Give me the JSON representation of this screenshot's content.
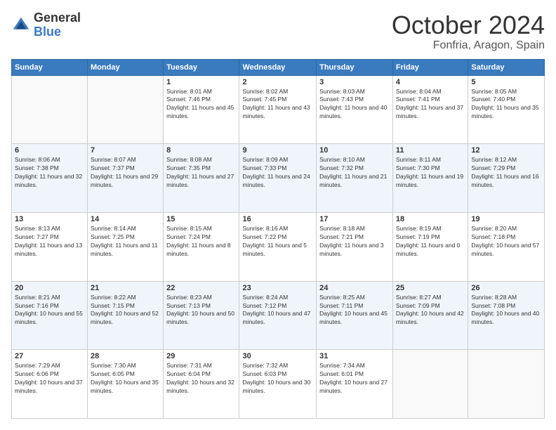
{
  "header": {
    "logo_general": "General",
    "logo_blue": "Blue",
    "month_title": "October 2024",
    "location": "Fonfria, Aragon, Spain"
  },
  "weekdays": [
    "Sunday",
    "Monday",
    "Tuesday",
    "Wednesday",
    "Thursday",
    "Friday",
    "Saturday"
  ],
  "weeks": [
    [
      {
        "day": "",
        "info": ""
      },
      {
        "day": "",
        "info": ""
      },
      {
        "day": "1",
        "info": "Sunrise: 8:01 AM\nSunset: 7:46 PM\nDaylight: 11 hours and 45 minutes."
      },
      {
        "day": "2",
        "info": "Sunrise: 8:02 AM\nSunset: 7:45 PM\nDaylight: 11 hours and 43 minutes."
      },
      {
        "day": "3",
        "info": "Sunrise: 8:03 AM\nSunset: 7:43 PM\nDaylight: 11 hours and 40 minutes."
      },
      {
        "day": "4",
        "info": "Sunrise: 8:04 AM\nSunset: 7:41 PM\nDaylight: 11 hours and 37 minutes."
      },
      {
        "day": "5",
        "info": "Sunrise: 8:05 AM\nSunset: 7:40 PM\nDaylight: 11 hours and 35 minutes."
      }
    ],
    [
      {
        "day": "6",
        "info": "Sunrise: 8:06 AM\nSunset: 7:38 PM\nDaylight: 11 hours and 32 minutes."
      },
      {
        "day": "7",
        "info": "Sunrise: 8:07 AM\nSunset: 7:37 PM\nDaylight: 11 hours and 29 minutes."
      },
      {
        "day": "8",
        "info": "Sunrise: 8:08 AM\nSunset: 7:35 PM\nDaylight: 11 hours and 27 minutes."
      },
      {
        "day": "9",
        "info": "Sunrise: 8:09 AM\nSunset: 7:33 PM\nDaylight: 11 hours and 24 minutes."
      },
      {
        "day": "10",
        "info": "Sunrise: 8:10 AM\nSunset: 7:32 PM\nDaylight: 11 hours and 21 minutes."
      },
      {
        "day": "11",
        "info": "Sunrise: 8:11 AM\nSunset: 7:30 PM\nDaylight: 11 hours and 19 minutes."
      },
      {
        "day": "12",
        "info": "Sunrise: 8:12 AM\nSunset: 7:29 PM\nDaylight: 11 hours and 16 minutes."
      }
    ],
    [
      {
        "day": "13",
        "info": "Sunrise: 8:13 AM\nSunset: 7:27 PM\nDaylight: 11 hours and 13 minutes."
      },
      {
        "day": "14",
        "info": "Sunrise: 8:14 AM\nSunset: 7:25 PM\nDaylight: 11 hours and 11 minutes."
      },
      {
        "day": "15",
        "info": "Sunrise: 8:15 AM\nSunset: 7:24 PM\nDaylight: 11 hours and 8 minutes."
      },
      {
        "day": "16",
        "info": "Sunrise: 8:16 AM\nSunset: 7:22 PM\nDaylight: 11 hours and 5 minutes."
      },
      {
        "day": "17",
        "info": "Sunrise: 8:18 AM\nSunset: 7:21 PM\nDaylight: 11 hours and 3 minutes."
      },
      {
        "day": "18",
        "info": "Sunrise: 8:19 AM\nSunset: 7:19 PM\nDaylight: 11 hours and 0 minutes."
      },
      {
        "day": "19",
        "info": "Sunrise: 8:20 AM\nSunset: 7:18 PM\nDaylight: 10 hours and 57 minutes."
      }
    ],
    [
      {
        "day": "20",
        "info": "Sunrise: 8:21 AM\nSunset: 7:16 PM\nDaylight: 10 hours and 55 minutes."
      },
      {
        "day": "21",
        "info": "Sunrise: 8:22 AM\nSunset: 7:15 PM\nDaylight: 10 hours and 52 minutes."
      },
      {
        "day": "22",
        "info": "Sunrise: 8:23 AM\nSunset: 7:13 PM\nDaylight: 10 hours and 50 minutes."
      },
      {
        "day": "23",
        "info": "Sunrise: 8:24 AM\nSunset: 7:12 PM\nDaylight: 10 hours and 47 minutes."
      },
      {
        "day": "24",
        "info": "Sunrise: 8:25 AM\nSunset: 7:11 PM\nDaylight: 10 hours and 45 minutes."
      },
      {
        "day": "25",
        "info": "Sunrise: 8:27 AM\nSunset: 7:09 PM\nDaylight: 10 hours and 42 minutes."
      },
      {
        "day": "26",
        "info": "Sunrise: 8:28 AM\nSunset: 7:08 PM\nDaylight: 10 hours and 40 minutes."
      }
    ],
    [
      {
        "day": "27",
        "info": "Sunrise: 7:29 AM\nSunset: 6:06 PM\nDaylight: 10 hours and 37 minutes."
      },
      {
        "day": "28",
        "info": "Sunrise: 7:30 AM\nSunset: 6:05 PM\nDaylight: 10 hours and 35 minutes."
      },
      {
        "day": "29",
        "info": "Sunrise: 7:31 AM\nSunset: 6:04 PM\nDaylight: 10 hours and 32 minutes."
      },
      {
        "day": "30",
        "info": "Sunrise: 7:32 AM\nSunset: 6:03 PM\nDaylight: 10 hours and 30 minutes."
      },
      {
        "day": "31",
        "info": "Sunrise: 7:34 AM\nSunset: 6:01 PM\nDaylight: 10 hours and 27 minutes."
      },
      {
        "day": "",
        "info": ""
      },
      {
        "day": "",
        "info": ""
      }
    ]
  ]
}
